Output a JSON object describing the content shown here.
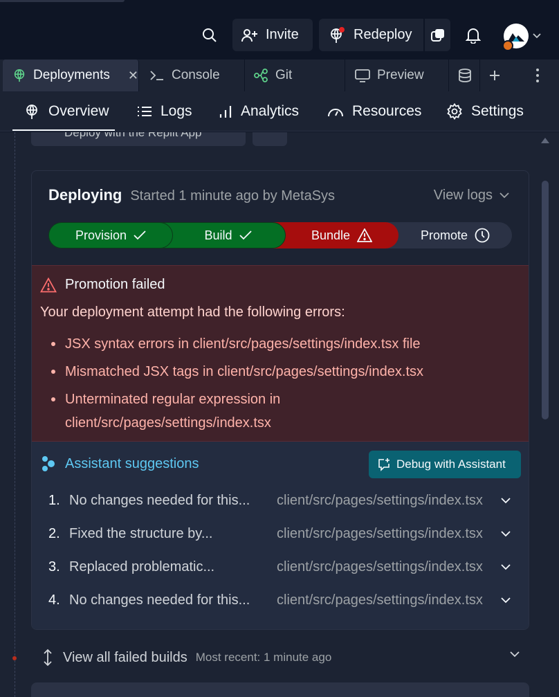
{
  "header": {
    "invite_label": "Invite",
    "redeploy_label": "Redeploy"
  },
  "tabs": [
    {
      "label": "Deployments",
      "active": true
    },
    {
      "label": "Console"
    },
    {
      "label": "Git"
    },
    {
      "label": "Preview"
    }
  ],
  "subnav": [
    {
      "label": "Overview",
      "icon": "deploy-icon"
    },
    {
      "label": "Logs",
      "icon": "list-icon"
    },
    {
      "label": "Analytics",
      "icon": "bar-chart-icon"
    },
    {
      "label": "Resources",
      "icon": "gauge-icon"
    },
    {
      "label": "Settings",
      "icon": "gear-icon"
    }
  ],
  "previous_card": {
    "label": "Deploy with the Replit App"
  },
  "deployment": {
    "status": "Deploying",
    "meta": "Started 1 minute ago by MetaSys",
    "view_logs": "View logs",
    "stages": [
      {
        "label": "Provision",
        "state": "success"
      },
      {
        "label": "Build",
        "state": "success"
      },
      {
        "label": "Bundle",
        "state": "error"
      },
      {
        "label": "Promote",
        "state": "pending"
      }
    ],
    "error": {
      "title": "Promotion failed",
      "intro": "Your deployment attempt had the following errors:",
      "items": [
        "JSX syntax errors in client/src/pages/settings/index.tsx file",
        "Mismatched JSX tags in client/src/pages/settings/index.tsx",
        "Unterminated regular expression in client/src/pages/settings/index.tsx"
      ]
    },
    "assistant": {
      "title": "Assistant suggestions",
      "debug_button": "Debug with Assistant",
      "suggestions": [
        {
          "num": "1.",
          "text": "No changes needed for this...",
          "file": "client/src/pages/settings/index.tsx"
        },
        {
          "num": "2.",
          "text": "Fixed the structure by...",
          "file": "client/src/pages/settings/index.tsx"
        },
        {
          "num": "3.",
          "text": "Replaced problematic...",
          "file": "client/src/pages/settings/index.tsx"
        },
        {
          "num": "4.",
          "text": "No changes needed for this...",
          "file": "client/src/pages/settings/index.tsx"
        }
      ]
    }
  },
  "failed_builds": {
    "label": "View all failed builds",
    "recent": "Most recent: 1 minute ago"
  },
  "colors": {
    "success": "#046f24",
    "error": "#a60d0d",
    "accent": "#5ec8f2",
    "error_bg": "#40222a"
  }
}
